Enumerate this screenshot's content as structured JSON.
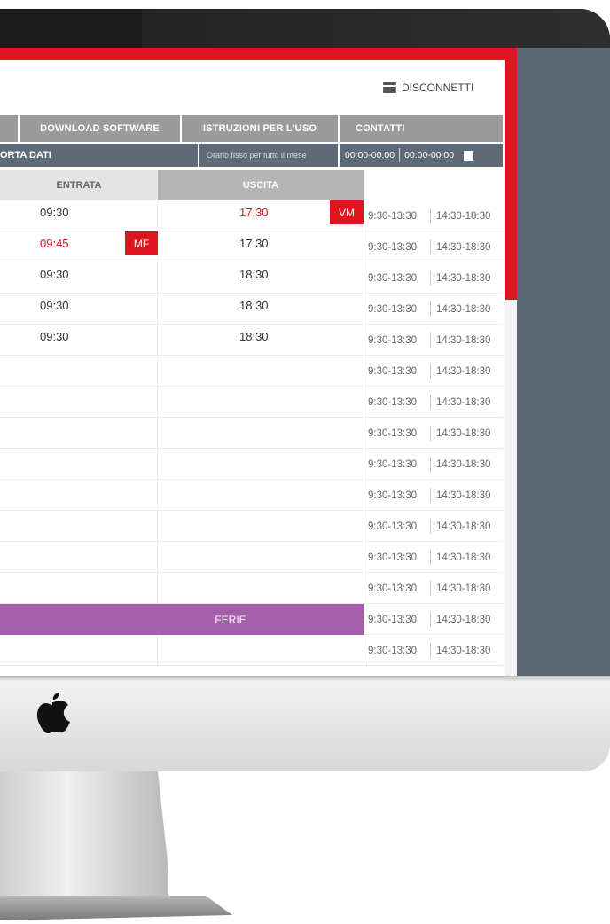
{
  "header": {
    "logout_label": "DISCONNETTI"
  },
  "nav": {
    "items": [
      {
        "label": ""
      },
      {
        "label": "DOWNLOAD SOFTWARE"
      },
      {
        "label": "ISTRUZIONI PER L'USO"
      },
      {
        "label": "CONTATTI"
      }
    ]
  },
  "data_bar": {
    "left_label": "ORTA DATI",
    "fixed_schedule_label": "Orario fisso per tutto il mese",
    "range1": "00:00-00:00",
    "range2": "00:00-00:00"
  },
  "table": {
    "col_entrata": "ENTRATA",
    "col_uscita": "USCITA",
    "rows": [
      {
        "entrata": "09:30",
        "entrata_red": false,
        "entrata_badge": "",
        "uscita": "17:30",
        "uscita_red": true,
        "uscita_badge": "VM",
        "s1": "9:30-13:30",
        "s2": "14:30-18:30"
      },
      {
        "entrata": "09:45",
        "entrata_red": true,
        "entrata_badge": "MF",
        "uscita": "17:30",
        "uscita_red": false,
        "uscita_badge": "",
        "s1": "9:30-13:30",
        "s2": "14:30-18:30"
      },
      {
        "entrata": "09:30",
        "entrata_red": false,
        "entrata_badge": "",
        "uscita": "18:30",
        "uscita_red": false,
        "uscita_badge": "",
        "s1": "9:30-13:30",
        "s2": "14:30-18:30"
      },
      {
        "entrata": "09:30",
        "entrata_red": false,
        "entrata_badge": "",
        "uscita": "18:30",
        "uscita_red": false,
        "uscita_badge": "",
        "s1": "9:30-13:30",
        "s2": "14:30-18:30"
      },
      {
        "entrata": "09:30",
        "entrata_red": false,
        "entrata_badge": "",
        "uscita": "18:30",
        "uscita_red": false,
        "uscita_badge": "",
        "s1": "9:30-13:30",
        "s2": "14:30-18:30"
      },
      {
        "entrata": "",
        "entrata_red": false,
        "entrata_badge": "",
        "uscita": "",
        "uscita_red": false,
        "uscita_badge": "",
        "s1": "9:30-13:30",
        "s2": "14:30-18:30"
      },
      {
        "entrata": "",
        "entrata_red": false,
        "entrata_badge": "",
        "uscita": "",
        "uscita_red": false,
        "uscita_badge": "",
        "s1": "9:30-13:30",
        "s2": "14:30-18:30"
      },
      {
        "entrata": "",
        "entrata_red": false,
        "entrata_badge": "",
        "uscita": "",
        "uscita_red": false,
        "uscita_badge": "",
        "s1": "9:30-13:30",
        "s2": "14:30-18:30"
      },
      {
        "entrata": "",
        "entrata_red": false,
        "entrata_badge": "",
        "uscita": "",
        "uscita_red": false,
        "uscita_badge": "",
        "s1": "9:30-13:30",
        "s2": "14:30-18:30"
      },
      {
        "entrata": "",
        "entrata_red": false,
        "entrata_badge": "",
        "uscita": "",
        "uscita_red": false,
        "uscita_badge": "",
        "s1": "9:30-13:30",
        "s2": "14:30-18:30"
      },
      {
        "entrata": "",
        "entrata_red": false,
        "entrata_badge": "",
        "uscita": "",
        "uscita_red": false,
        "uscita_badge": "",
        "s1": "9:30-13:30",
        "s2": "14:30-18:30"
      },
      {
        "entrata": "",
        "entrata_red": false,
        "entrata_badge": "",
        "uscita": "",
        "uscita_red": false,
        "uscita_badge": "",
        "s1": "9:30-13:30",
        "s2": "14:30-18:30"
      },
      {
        "entrata": "",
        "entrata_red": false,
        "entrata_badge": "",
        "uscita": "",
        "uscita_red": false,
        "uscita_badge": "",
        "s1": "9:30-13:30",
        "s2": "14:30-18:30"
      },
      {
        "ferie": "FERIE",
        "s1": "9:30-13:30",
        "s2": "14:30-18:30"
      },
      {
        "entrata": "",
        "entrata_red": false,
        "entrata_badge": "",
        "uscita": "",
        "uscita_red": false,
        "uscita_badge": "",
        "s1": "9:30-13:30",
        "s2": "14:30-18:30"
      }
    ]
  },
  "colors": {
    "accent_red": "#e0141e",
    "slate": "#5d6a78",
    "ferie_purple": "#a55ea9"
  }
}
